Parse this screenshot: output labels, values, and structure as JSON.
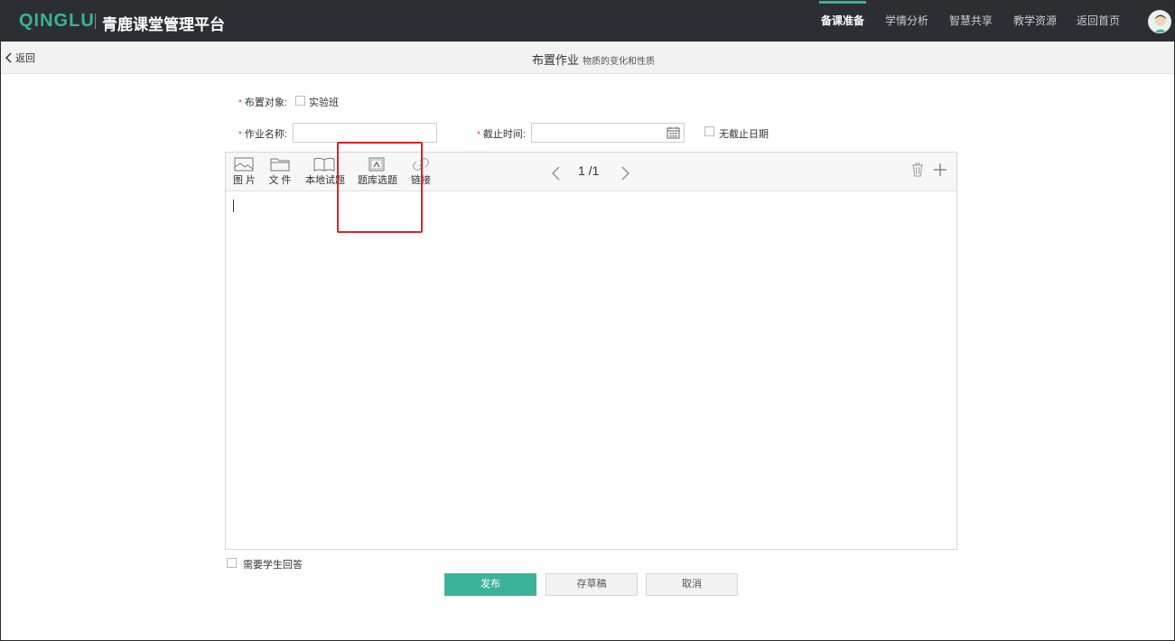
{
  "header": {
    "logo_en": "QINGLU",
    "logo_cn": "青鹿课堂管理平台",
    "nav": [
      {
        "label": "备课准备",
        "active": true
      },
      {
        "label": "学情分析",
        "active": false
      },
      {
        "label": "智慧共享",
        "active": false
      },
      {
        "label": "教学资源",
        "active": false
      },
      {
        "label": "返回首页",
        "active": false
      }
    ],
    "avatar_icon": "user-avatar"
  },
  "subbar": {
    "back_label": "返回",
    "title": "布置作业",
    "subtitle": "物质的变化和性质"
  },
  "form": {
    "required_mark": "*",
    "target_label": "布置对象:",
    "target_option": "实验班",
    "name_label": "作业名称:",
    "name_value": "",
    "deadline_label": "截止时间:",
    "deadline_value": "",
    "no_deadline_label": "无截止日期"
  },
  "toolbar": {
    "tools": [
      {
        "label": "图 片",
        "icon": "image-icon"
      },
      {
        "label": "文 件",
        "icon": "folder-icon"
      },
      {
        "label": "本地试题",
        "icon": "book-icon"
      },
      {
        "label": "题库选题",
        "icon": "question-bank-icon"
      },
      {
        "label": "链接",
        "icon": "link-icon"
      }
    ],
    "page_indicator": "1 /1"
  },
  "footer": {
    "need_answer_label": "需要学生回答",
    "publish_label": "发布",
    "draft_label": "存草稿",
    "cancel_label": "取消"
  },
  "colors": {
    "accent": "#3bb39a",
    "topbar": "#2b2f33",
    "highlight": "#e02020"
  }
}
